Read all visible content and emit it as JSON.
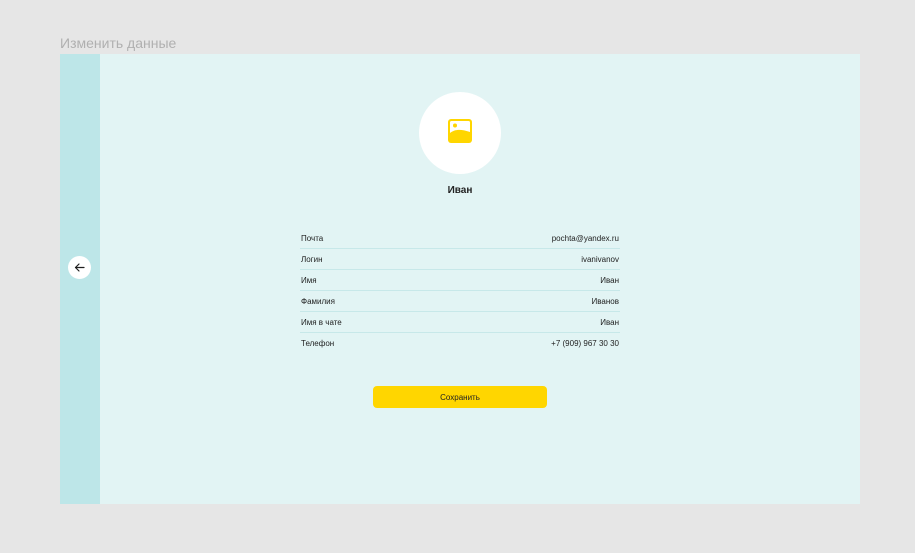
{
  "page": {
    "title": "Изменить данные"
  },
  "nav": {
    "back_icon": "arrow-left-icon"
  },
  "profile": {
    "avatar_icon": "image-icon",
    "name": "Иван"
  },
  "fields": [
    {
      "label": "Почта",
      "value": "pochta@yandex.ru"
    },
    {
      "label": "Логин",
      "value": "ivanivanov"
    },
    {
      "label": "Имя",
      "value": "Иван"
    },
    {
      "label": "Фамилия",
      "value": "Иванов"
    },
    {
      "label": "Имя в чате",
      "value": "Иван"
    },
    {
      "label": "Телефон",
      "value": "+7 (909) 967 30 30"
    }
  ],
  "actions": {
    "save_label": "Сохранить"
  },
  "colors": {
    "page_background": "#e6e6e6",
    "panel_background": "#e2f4f4",
    "side_strip": "#bde6e8",
    "accent": "#ffd600",
    "divider": "#c7e8e9"
  }
}
